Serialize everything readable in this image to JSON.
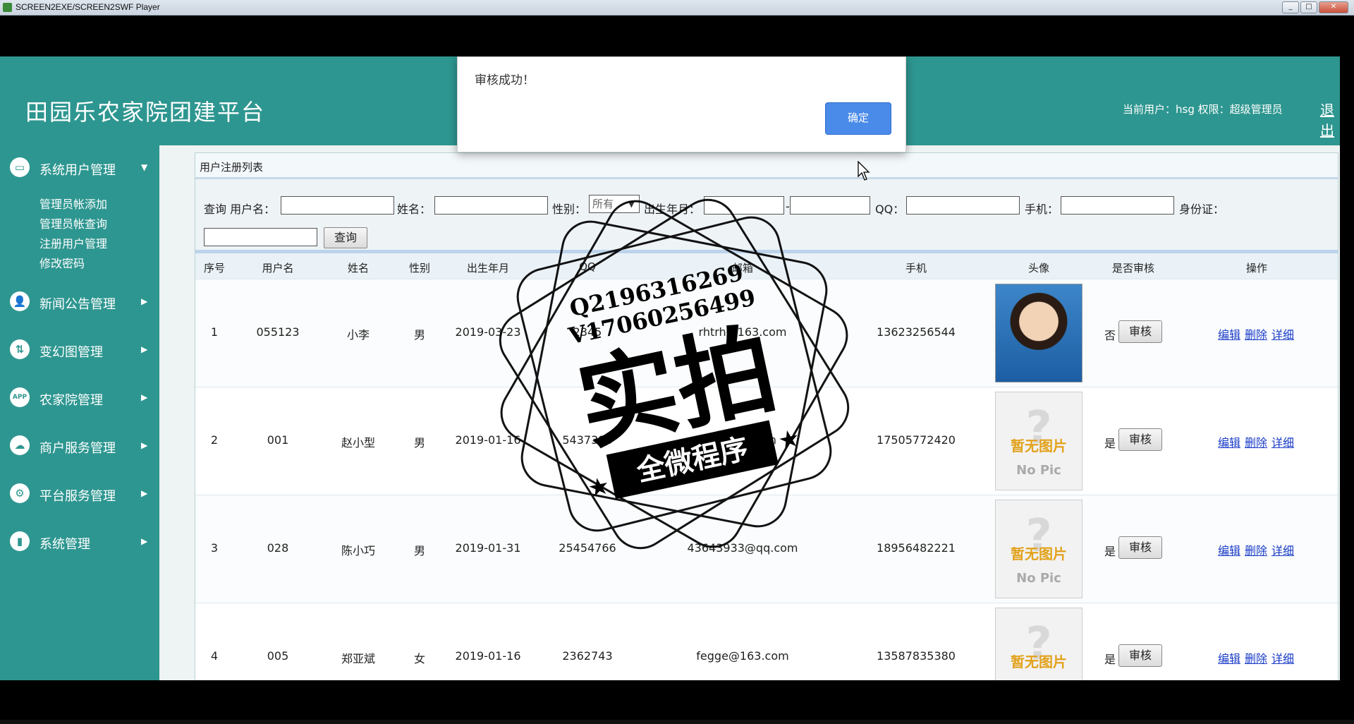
{
  "window": {
    "title": "SCREEN2EXE/SCREEN2SWF Player",
    "min_btn": "_",
    "max_btn": "□",
    "close_btn": "✕"
  },
  "header": {
    "logo": "田园乐农家院团建平台",
    "user_info": "当前用户：hsg 权限：超级管理员",
    "logout": "退出"
  },
  "sidebar": {
    "system_user": {
      "label": "系统用户管理",
      "arrow": "▼",
      "icon": "monitor-icon",
      "items": [
        "管理员帐添加",
        "管理员帐查询",
        "注册用户管理",
        "修改密码"
      ]
    },
    "menus": [
      {
        "label": "新闻公告管理",
        "icon": "user-gear-icon",
        "glyph": "👤",
        "arrow": "▶"
      },
      {
        "label": "变幻图管理",
        "icon": "transform-icon",
        "glyph": "⇅",
        "arrow": "▶"
      },
      {
        "label": "农家院管理",
        "icon": "app-icon",
        "glyph": "APP",
        "arrow": "▶"
      },
      {
        "label": "商户服务管理",
        "icon": "cloud-icon",
        "glyph": "☁",
        "arrow": "▶"
      },
      {
        "label": "平台服务管理",
        "icon": "gear-icon",
        "glyph": "⚙",
        "arrow": "▶"
      },
      {
        "label": "系统管理",
        "icon": "bar-chart-icon",
        "glyph": "▮",
        "arrow": "▶"
      }
    ]
  },
  "panel": {
    "title": "用户注册列表"
  },
  "search": {
    "query_label": "查询 用户名：",
    "name_label": "姓名：",
    "gender_label": "性别：",
    "gender_value": "所有",
    "birth_label": "出生年月：",
    "range_sep": "-",
    "qq_label": "QQ：",
    "phone_label": "手机：",
    "idcard_label": "身份证：",
    "submit": "查询"
  },
  "table": {
    "headers": [
      "序号",
      "用户名",
      "姓名",
      "性别",
      "出生年月",
      "QQ",
      "邮箱",
      "手机",
      "头像",
      "是否审核",
      "操作"
    ],
    "audit_button": "审核",
    "op_edit": "编辑",
    "op_delete": "删除",
    "op_detail": "详细",
    "nopic_cn": "暂无图片",
    "nopic_en": "No Pic",
    "rows": [
      {
        "no": "1",
        "username": "055123",
        "name": "小李",
        "gender": "男",
        "birth": "2019-03-23",
        "qq": "2345",
        "email": "rhtrh@163.com",
        "phone": "13623256544",
        "avatar": "photo",
        "audited": "否"
      },
      {
        "no": "2",
        "username": "001",
        "name": "赵小型",
        "gender": "男",
        "birth": "2019-01-16",
        "qq": "5437393",
        "email": "34@qq.com",
        "phone": "17505772420",
        "avatar": "nopic",
        "audited": "是"
      },
      {
        "no": "3",
        "username": "028",
        "name": "陈小巧",
        "gender": "男",
        "birth": "2019-01-31",
        "qq": "25454766",
        "email": "43643933@qq.com",
        "phone": "18956482221",
        "avatar": "nopic",
        "audited": "是"
      },
      {
        "no": "4",
        "username": "005",
        "name": "郑亚斌",
        "gender": "女",
        "birth": "2019-01-16",
        "qq": "2362743",
        "email": "fegge@163.com",
        "phone": "13587835380",
        "avatar": "nopic",
        "audited": "是"
      }
    ]
  },
  "dialog": {
    "message": "审核成功！",
    "ok": "确定"
  },
  "watermark": {
    "line1": "Q2196316269",
    "line2": "V17060256499",
    "big": "实拍",
    "banner": "全微程序"
  }
}
